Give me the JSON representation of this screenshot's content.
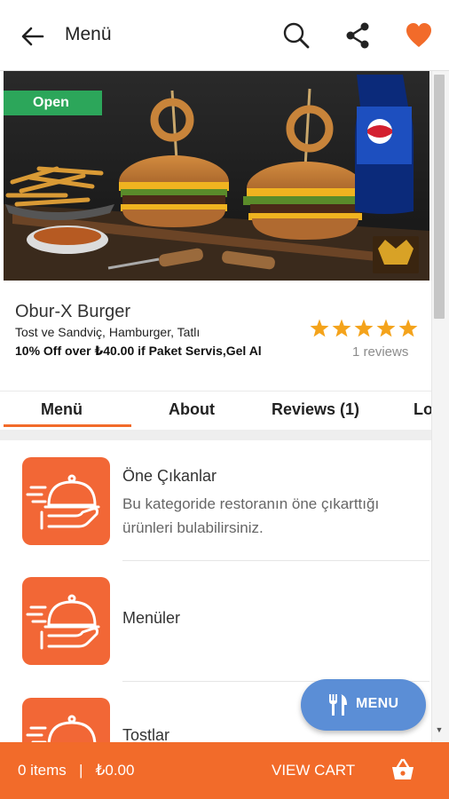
{
  "appbar": {
    "title": "Menü",
    "back_icon": "arrow-left-icon",
    "search_icon": "search-icon",
    "share_icon": "share-icon",
    "favorite_icon": "heart-icon",
    "favorite_color": "#f26b2a"
  },
  "hero": {
    "status_badge": "Open",
    "status_color": "#2ca65a"
  },
  "restaurant": {
    "name": "Obur-X Burger",
    "categories": "Tost ve Sandviç, Hamburger, Tatlı",
    "offer": "10% Off over ₺40.00 if Paket Servis,Gel Al",
    "rating": 5,
    "rating_max": 5,
    "reviews": "1 reviews",
    "star_color": "#f4a31b"
  },
  "tabs": [
    {
      "label": "Menü",
      "active": true
    },
    {
      "label": "About",
      "active": false
    },
    {
      "label": "Reviews (1)",
      "active": false
    },
    {
      "label": "Lo",
      "active": false
    }
  ],
  "menu_categories": [
    {
      "title": "Öne Çıkanlar",
      "description": "Bu kategoride restoranın öne çıkarttığı ürünleri bulabilirsiniz.",
      "icon": "food-delivery-cloche-icon"
    },
    {
      "title": "Menüler",
      "description": "",
      "icon": "food-delivery-cloche-icon"
    },
    {
      "title": "Tostlar",
      "description": "",
      "icon": "food-delivery-cloche-icon"
    }
  ],
  "fab": {
    "label": "MENU",
    "icon": "fork-knife-icon",
    "color": "#5b8ed6"
  },
  "cart": {
    "items": "0 items",
    "separator": "|",
    "total": "₺0.00",
    "action": "VIEW CART",
    "icon": "basket-icon",
    "bar_color": "#f26b2a"
  }
}
